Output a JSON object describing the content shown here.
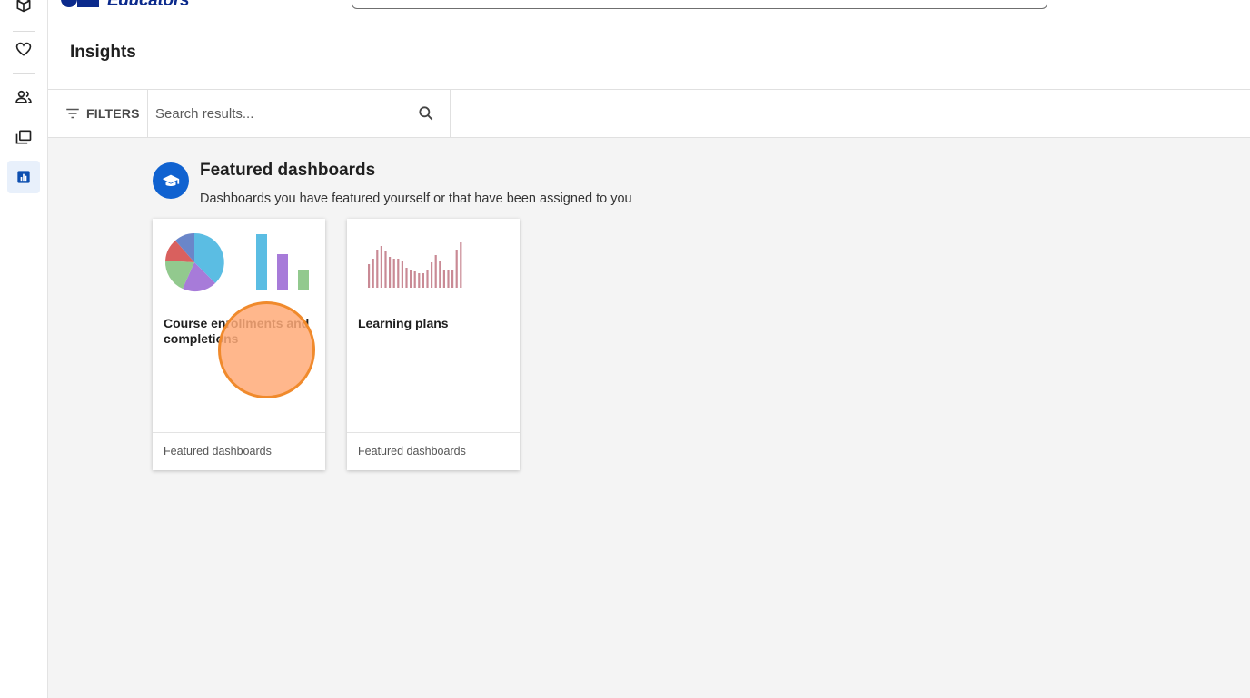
{
  "header": {
    "logo_text": "Educators",
    "page_title": "Insights"
  },
  "toolbar": {
    "filters_label": "FILTERS",
    "search_placeholder": "Search results..."
  },
  "section": {
    "title": "Featured dashboards",
    "subtitle": "Dashboards you have featured yourself or that have been assigned to you"
  },
  "cards": [
    {
      "title": "Course enrollments and completions",
      "footer": "Featured dashboards"
    },
    {
      "title": "Learning plans",
      "footer": "Featured dashboards"
    }
  ],
  "colors": {
    "accent": "#1062d0",
    "active_rail_bg": "#e8f0fb",
    "content_bg": "#f4f4f4",
    "pie_blue": "#5bbde3",
    "pie_purple": "#a77bd9",
    "pie_green": "#92c98e",
    "pie_red": "#d9605e",
    "pie_slate": "#6a86c9",
    "bar_color": "#c98a95",
    "click_marker": "#f08a2c"
  },
  "icons": {
    "rail": [
      "box-icon",
      "heart-icon",
      "people-icon",
      "library-icon",
      "bar-chart-icon"
    ],
    "filters": "filter-lines-icon",
    "search": "search-icon",
    "section": "graduation-cap-icon"
  }
}
